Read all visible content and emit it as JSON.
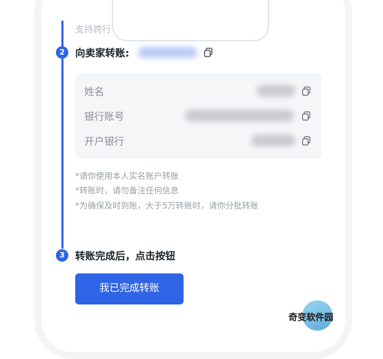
{
  "header": {
    "note_text": "支持跨行"
  },
  "steps": [
    {
      "number": "2",
      "title": "向卖家转账:"
    },
    {
      "number": "3",
      "title": "转账完成后，点击按钮"
    }
  ],
  "info_card": {
    "rows": [
      {
        "label": "姓名"
      },
      {
        "label": "银行账号"
      },
      {
        "label": "开户银行"
      }
    ]
  },
  "notes": [
    "*请你使用本人实名账户转账",
    "*转账时，请勿备注任何信息",
    "*为确保及时到账，大于5万转账时，请你分批转账"
  ],
  "actions": {
    "done_label": "我已完成转账"
  },
  "watermark": {
    "text": "奇变软件园"
  },
  "colors": {
    "accent": "#2f64e6",
    "card_background": "#f5f6f8",
    "label_gray": "#8a8e96",
    "note_gray": "#9aa0a6"
  },
  "icons": {
    "copy": "copy-icon"
  }
}
